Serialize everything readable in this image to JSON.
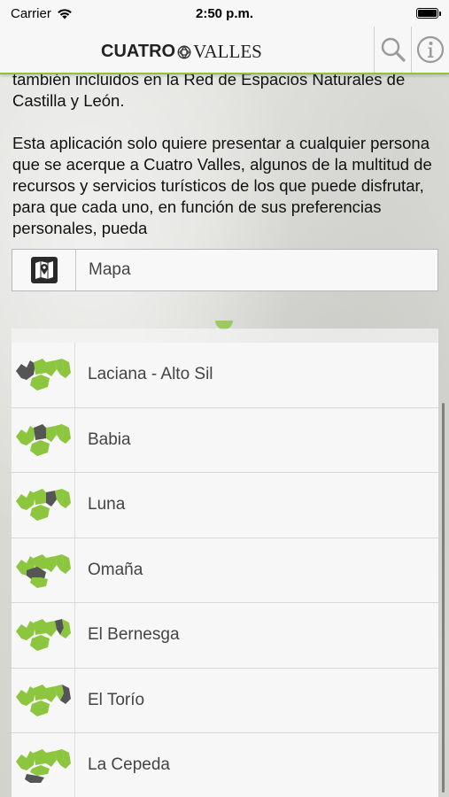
{
  "status": {
    "carrier": "Carrier",
    "time": "2:50 p.m."
  },
  "header": {
    "logo_bold": "CUATRO",
    "logo_light": "VALLES",
    "search_icon": "search-icon",
    "info_icon": "info-icon"
  },
  "intro": {
    "paragraph1": "también incluidos en la Red de Espacios Naturales de Castilla y León.",
    "paragraph2": "Esta aplicación solo quiere presentar a cualquier persona que se acerque a Cuatro Valles, algunos de la multitud de recursos y servicios turísticos de los que puede disfrutar, para que cada uno, en función de sus preferencias personales, pueda"
  },
  "map": {
    "icon": "map-pin-icon",
    "label": "Mapa"
  },
  "colors": {
    "accent_green": "#8cc63f",
    "highlight_gray": "#555555"
  },
  "regions": [
    {
      "label": "Laciana - Alto Sil",
      "icon": "region-map-icon",
      "highlight": "west"
    },
    {
      "label": "Babia",
      "icon": "region-map-icon",
      "highlight": "north-west"
    },
    {
      "label": "Luna",
      "icon": "region-map-icon",
      "highlight": "centre"
    },
    {
      "label": "Omaña",
      "icon": "region-map-icon",
      "highlight": "south-west"
    },
    {
      "label": "El Bernesga",
      "icon": "region-map-icon",
      "highlight": "east"
    },
    {
      "label": "El Torío",
      "icon": "region-map-icon",
      "highlight": "far-east"
    },
    {
      "label": "La Cepeda",
      "icon": "region-map-icon",
      "highlight": "south"
    }
  ]
}
